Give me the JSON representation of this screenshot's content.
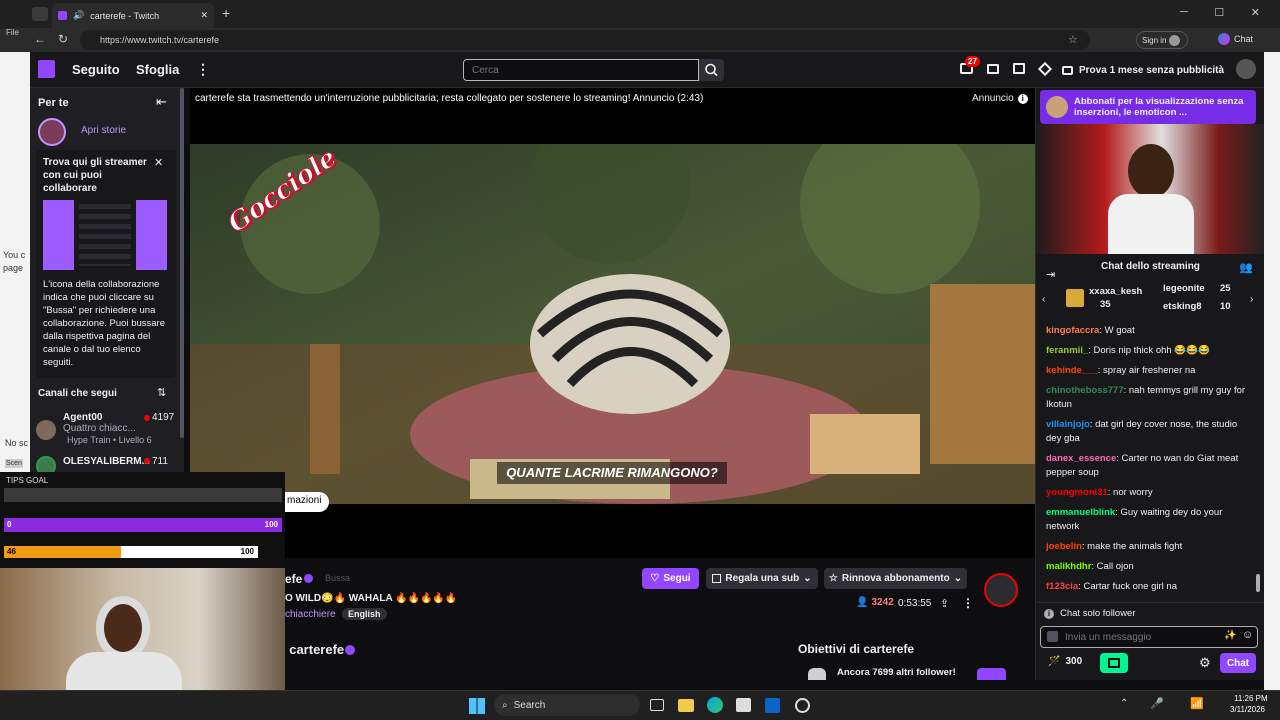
{
  "browser": {
    "tab_title": "carterefe - Twitch",
    "url": "https://www.twitch.tv/carterefe",
    "sign_in": "Sign in",
    "chat_button": "Chat"
  },
  "left_page": {
    "file_label": "File",
    "you_label": "You c",
    "page_label": "page",
    "no_label": "No sc",
    "scene_label": "Scen"
  },
  "nav": {
    "following": "Seguito",
    "browse": "Sfoglia",
    "search_placeholder": "Cerca",
    "notif_count": "27",
    "promo": "Prova 1 mese senza pubblicità"
  },
  "sidebar": {
    "for_you": "Per te",
    "open_stories": "Apri storie",
    "collab_title": "Trova qui gli streamer con cui puoi collaborare",
    "collab_body": "L'icona della collaborazione indica che puoi cliccare su \"Bussa\" per richiedere una collaborazione. Puoi bussare dalla rispettiva pagina del canale o dal tuo elenco seguiti.",
    "channels_header": "Canali che segui",
    "channels": [
      {
        "name": "Agent00",
        "category": "Quattro chiacc...",
        "viewers": "4197",
        "extra": "Hype Train • Livello 6"
      },
      {
        "name": "OLESYALIBERM...",
        "category": "Quattro chiacc...",
        "viewers": "711",
        "extra": ""
      }
    ]
  },
  "player": {
    "ad_notice": "carterefe sta trasmettendo un'interruzione pubblicitaria; resta collegato per sostenere lo streaming! Annuncio (2:43)",
    "ad_label": "Annuncio",
    "logo_text": "Gocciole",
    "subtitle": "QUANTE LACRIME RIMANGONO?",
    "more_info": "mazioni"
  },
  "channel": {
    "name_fragment": "efe",
    "knock": "Bussa",
    "title": "O WILD😳🔥 WAHALA 🔥🔥🔥🔥🔥",
    "category": "chiacchiere",
    "language": "English",
    "follow": "Segui",
    "gift_sub": "Regala una sub",
    "resub": "Rinnova abbonamento",
    "viewers": "3242",
    "uptime": "0:53:55",
    "about": "i carterefe",
    "goals_title": "Obiettivi di carterefe",
    "goal_text": "Ancora 7699 altri follower!"
  },
  "chat": {
    "sub_banner": "Abbonati per la visualizzazione senza inserzioni, le emoticon ...",
    "header": "Chat dello streaming",
    "gifters": [
      {
        "name": "xxaxa_kesh",
        "count": "35"
      },
      {
        "name": "legeonite",
        "count": "25"
      },
      {
        "name": "etsking8",
        "count": "10"
      }
    ],
    "messages": [
      {
        "user": "kingofaccra",
        "text": ": W goat",
        "color": "#ff7f50"
      },
      {
        "user": "feranmii_",
        "text": ": Doris nip thick ohh 😂😂😂",
        "color": "#9acd32"
      },
      {
        "user": "kehinde___",
        "text": ": spray air freshener na",
        "color": "#ff4500"
      },
      {
        "user": "chinotheboss777",
        "text": ": nah temmys grill my guy for Ikotun",
        "color": "#2e8b57"
      },
      {
        "user": "villainjojo",
        "text": ": dat girl dey cover nose, the studio dey gba",
        "color": "#1e90ff"
      },
      {
        "user": "danex_essence",
        "text": ": Carter no wan do Giat meat pepper soup",
        "color": "#ff69b4"
      },
      {
        "user": "youngmoni31",
        "text": ": nor worry",
        "color": "#ff0000"
      },
      {
        "user": "emmanuelblink",
        "text": ": Guy waiting dey do your network",
        "color": "#00ff7f"
      },
      {
        "user": "joebelin",
        "text": ": make the animals fight",
        "color": "#ff4500"
      },
      {
        "user": "malikhdhr",
        "text": ": Call ojon",
        "color": "#7fff00"
      },
      {
        "user": "f123cia",
        "text": ": Cartar fuck one girl na",
        "color": "#ff4040"
      }
    ],
    "followers_only": "Chat solo follower",
    "input_placeholder": "Invia un messaggio",
    "points": "300",
    "send": "Chat"
  },
  "overlay": {
    "tips_goal": "TIPS GOAL",
    "bar1_start": "0",
    "bar1_end": "100",
    "bar1_fraction": 1.0,
    "bar2_start": "46",
    "bar2_end": "100",
    "bar2_fraction": 0.46
  },
  "taskbar": {
    "search": "Search",
    "time": "11:26 PM",
    "date": "3/11/2026"
  }
}
